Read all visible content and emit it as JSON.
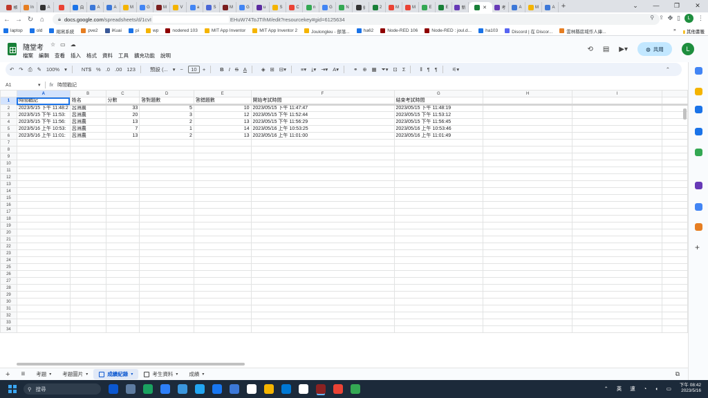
{
  "browser": {
    "tabs": [
      {
        "label": "帳",
        "color": "#c0392b"
      },
      {
        "label": "In",
        "color": "#e67e22"
      },
      {
        "label": "A",
        "color": "#333333"
      },
      {
        "label": "",
        "color": "#ea4335"
      },
      {
        "label": "自",
        "color": "#1a73e8"
      },
      {
        "label": "A",
        "color": "#3c78d8"
      },
      {
        "label": "A",
        "color": "#3c78d8"
      },
      {
        "label": "M",
        "color": "#f4b400"
      },
      {
        "label": "G",
        "color": "#4285f4"
      },
      {
        "label": "M",
        "color": "#7b1f1f"
      },
      {
        "label": "V",
        "color": "#f4b400"
      },
      {
        "label": "a",
        "color": "#4285f4"
      },
      {
        "label": "S",
        "color": "#4a67d6"
      },
      {
        "label": "M",
        "color": "#7b1f1f"
      },
      {
        "label": "G",
        "color": "#4285f4"
      },
      {
        "label": "u",
        "color": "#5b2ca0"
      },
      {
        "label": "S",
        "color": "#f4b400"
      },
      {
        "label": "C",
        "color": "#ea4335"
      },
      {
        "label": "n",
        "color": "#34a853"
      },
      {
        "label": "G",
        "color": "#4285f4"
      },
      {
        "label": "N",
        "color": "#34a853"
      },
      {
        "label": "g",
        "color": "#333333"
      },
      {
        "label": "2",
        "color": "#188038"
      },
      {
        "label": "M",
        "color": "#ea4335"
      },
      {
        "label": "M",
        "color": "#ea4335"
      },
      {
        "label": "E",
        "color": "#34a853"
      },
      {
        "label": "E",
        "color": "#188038"
      },
      {
        "label": "新",
        "color": "#673ab7"
      },
      {
        "label": "",
        "color": "#188038"
      },
      {
        "label": "考",
        "color": "#673ab7"
      },
      {
        "label": "A",
        "color": "#3c78d8"
      },
      {
        "label": "M",
        "color": "#f4b400"
      },
      {
        "label": "A",
        "color": "#3c78d8"
      }
    ],
    "active_tab_index": 28,
    "new_tab": "+",
    "window_buttons": [
      "⌄",
      "—",
      "❐",
      "✕"
    ],
    "url_host": "docs.google.com",
    "url_path_start": "/spreadsheets/d/1cvI",
    "url_path_end": "EHuW74ToJTIhM/edit?resourcekey#gid=6125634",
    "profile_initial": "L"
  },
  "bookmarks": {
    "items": [
      {
        "label": "laptop",
        "color": "#1a73e8"
      },
      {
        "label": "old",
        "color": "#1a73e8"
      },
      {
        "label": "縮寫系統",
        "color": "#1a73e8"
      },
      {
        "label": "pve2",
        "color": "#e67e22"
      },
      {
        "label": "iKuai",
        "color": "#3b5998"
      },
      {
        "label": "pi",
        "color": "#1a73e8"
      },
      {
        "label": "wp",
        "color": "#f4b400"
      },
      {
        "label": "nodered 103",
        "color": "#8f0000"
      },
      {
        "label": "MIT App Inventor",
        "color": "#f4b400"
      },
      {
        "label": "MIT App Inventor 2",
        "color": "#f4b400"
      },
      {
        "label": "Joulongleu - 部落...",
        "color": "#f4b400"
      },
      {
        "label": "ha62",
        "color": "#1a73e8"
      },
      {
        "label": "Node-RED 106",
        "color": "#8f0000"
      },
      {
        "label": "Node-RED : joul.d...",
        "color": "#8f0000"
      },
      {
        "label": "ha103",
        "color": "#1a73e8"
      },
      {
        "label": "Discord | 在 Discor...",
        "color": "#5865f2"
      },
      {
        "label": "雲林縣區域作人庫...",
        "color": "#e67e22"
      }
    ],
    "overflow": "»",
    "other": "其他書籤"
  },
  "sheets": {
    "title": "隨堂考",
    "menu": [
      "檔案",
      "編輯",
      "查看",
      "插入",
      "格式",
      "資料",
      "工具",
      "擴充功能",
      "說明"
    ],
    "share_label": "共用",
    "user_initial": "L",
    "toolbar": {
      "zoom": "100%",
      "currency": "NT$",
      "percent": "%",
      "dec_minus": ".0",
      "dec_plus": ".00",
      "number_format": "123",
      "font": "預設 (...",
      "font_size": "10",
      "minus": "−",
      "plus": "+"
    },
    "name_box": "A1",
    "fx": "fx",
    "formula": "時間戳記"
  },
  "grid": {
    "columns": [
      "A",
      "B",
      "C",
      "D",
      "E",
      "F",
      "G",
      "H",
      "I"
    ],
    "header_row": [
      "時間戳記",
      "姓名",
      "分數",
      "答對題數",
      "答錯題數",
      "開始考試時間",
      "結束考試時間",
      "",
      ""
    ],
    "rows": [
      [
        "2023/5/15 下午 11:48:2",
        "呂洲農",
        "33",
        "5",
        "10",
        "2023/05/15 下午 11:47:47",
        "2023/05/15 下午 11:48:19",
        "",
        ""
      ],
      [
        "2023/5/15 下午 11:53:",
        "呂洲農",
        "20",
        "3",
        "12",
        "2023/05/15 下午 11:52:44",
        "2023/05/15 下午 11:53:12",
        "",
        ""
      ],
      [
        "2023/5/15 下午 11:56:",
        "呂洲農",
        "13",
        "2",
        "13",
        "2023/05/15 下午 11:56:29",
        "2023/05/15 下午 11:56:45",
        "",
        ""
      ],
      [
        "2023/5/16 上午 10:53:",
        "呂洲農",
        "7",
        "1",
        "14",
        "2023/05/16 上午 10:53:25",
        "2023/05/16 上午 10:53:46",
        "",
        ""
      ],
      [
        "2023/5/16 上午 11:01:",
        "呂洲農",
        "13",
        "2",
        "13",
        "2023/05/16 上午 11:01:00",
        "2023/05/16 上午 11:01:49",
        "",
        ""
      ]
    ],
    "total_rows": 34
  },
  "sheet_tabs": {
    "add": "+",
    "all": "≡",
    "tabs": [
      {
        "label": "考題",
        "active": false
      },
      {
        "label": "考題圖片",
        "active": false
      },
      {
        "label": "成績紀錄",
        "active": true
      },
      {
        "label": "考生資料",
        "active": false
      },
      {
        "label": "成績",
        "active": false
      }
    ]
  },
  "taskbar": {
    "search_placeholder": "搜尋",
    "apps": [
      "#0b57d0",
      "#5e7ca0",
      "#1aa260",
      "#2d7ff9",
      "#3a96dd",
      "#22a6f2",
      "#1877f2",
      "#3c78d8",
      "#ffffff",
      "#f4b400",
      "#0078d4",
      "#ffffff",
      "#8b2222",
      "#ea4335",
      "#34a853"
    ],
    "ime": [
      "英",
      "速"
    ],
    "time": "下午 08:42",
    "date": "2023/5/16"
  },
  "side_panel": [
    {
      "name": "calendar-icon",
      "color": "#4285f4"
    },
    {
      "name": "keep-icon",
      "color": "#f4b400"
    },
    {
      "name": "tasks-icon",
      "color": "#1a73e8"
    },
    {
      "name": "contacts-icon",
      "color": "#1a73e8"
    },
    {
      "name": "maps-icon",
      "color": "#34a853"
    },
    {
      "name": "addon-icon",
      "color": "#673ab7"
    },
    {
      "name": "addon-icon-2",
      "color": "#4285f4"
    },
    {
      "name": "addon-icon-3",
      "color": "#e67e22"
    }
  ]
}
